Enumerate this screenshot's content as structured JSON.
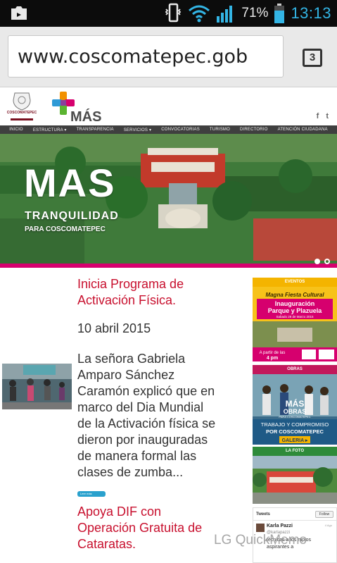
{
  "status_bar": {
    "battery_percent": "71%",
    "time": "13:13",
    "icons": [
      "screenshot-icon",
      "vibrate-icon",
      "wifi-icon",
      "signal-icon",
      "battery-icon"
    ]
  },
  "browser": {
    "url": "www.coscomatepec.gob",
    "tab_count": "3"
  },
  "header": {
    "crest_label": "COSCOMATEPEC",
    "logo_text": "MÁS",
    "social": [
      "f",
      "t"
    ]
  },
  "nav": {
    "items": [
      "INICIO",
      "ESTRUCTURA ▾",
      "TRANSPARENCIA",
      "SERVICIOS ▾",
      "CONVOCATORIAS",
      "TURISMO",
      "DIRECTORIO",
      "ATENCIÓN CIUDADANA"
    ]
  },
  "hero": {
    "title": "MAS",
    "subtitle": "TRANQUILIDAD",
    "subtitle2": "PARA COSCOMATEPEC"
  },
  "posts": [
    {
      "title_line1": "Inicia Programa de",
      "title_line2": "Activación Física.",
      "date": "10 abril 2015",
      "excerpt": [
        "La señora Gabriela",
        "Amparo Sánchez",
        "Caramón explicó que en",
        "marco del Dia Mundial",
        "de la Activación física se",
        "dieron por inauguradas",
        "de manera formal las",
        "clases de zumba..."
      ],
      "read_more": "Leer más"
    },
    {
      "title_line1": "Apoya DIF con",
      "title_line2": "Operación Gratuita de",
      "title_line3": "Cataratas."
    }
  ],
  "sidebar": {
    "eventos": {
      "header": "EVENTOS",
      "line1": "Magna Fiesta Cultural",
      "line2": "Inauguración",
      "line3": "Parque y Plazuela",
      "line4": "Sabado 28 de Marzo 2015",
      "line5": "A partir de las",
      "line6": "4 pm"
    },
    "obras": {
      "header": "OBRAS",
      "logo": "MÁS",
      "sub": "OBRAS",
      "sub2": "PARA COSCOMATEPEC",
      "line1": "TRABAJO Y COMPROMISO",
      "line2": "POR COSCOMATEPEC",
      "gallery": "GALERIA ▸"
    },
    "foto": {
      "header": "LA FOTO"
    },
    "tweets": {
      "header": "Tweets",
      "follow": "Follow",
      "user": "Karla Pazzi",
      "handle": "@karlapazzi",
      "age": "4 Ago",
      "text1": "técnicas a los mpios",
      "text2": "aspirantes a"
    }
  },
  "watermark": "LG QuickMemo",
  "colors": {
    "accent_red": "#c8102e",
    "clock_blue": "#33b5e5",
    "nav_bg": "#3f3f3f",
    "eventos_yellow": "#f4b400",
    "obras_magenta": "#c2185b",
    "foto_green": "#2e8b3a"
  }
}
